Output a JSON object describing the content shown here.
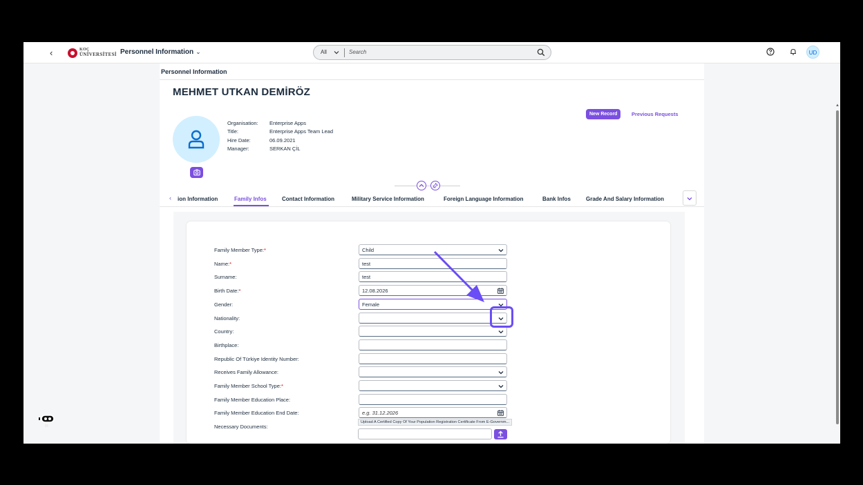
{
  "shell": {
    "back_icon": "chevron-left-icon",
    "logo_line1": "KOÇ",
    "logo_line2": "ÜNİVERSİTESİ",
    "app_title": "Personnel Information",
    "search_scope": "All",
    "search_placeholder": "Search",
    "avatar_initials": "UD"
  },
  "page": {
    "title": "Personnel Information",
    "employee_name": "MEHMET UTKAN DEMİRÖZ",
    "new_record_label": "New Record",
    "previous_requests_label": "Previous Requests"
  },
  "employee_info": [
    {
      "key": "Organisation:",
      "value": "Enterprise Apps"
    },
    {
      "key": "Title:",
      "value": "Enterprise Apps Team Lead"
    },
    {
      "key": "Hire Date:",
      "value": "06.09.2021"
    },
    {
      "key": "Manager:",
      "value": "SERKAN ÇİL"
    }
  ],
  "tabs": [
    {
      "label": "ion Information",
      "active": false
    },
    {
      "label": "Family Infos",
      "active": true
    },
    {
      "label": "Contact Information",
      "active": false
    },
    {
      "label": "Military Service Information",
      "active": false
    },
    {
      "label": "Foreign Language Information",
      "active": false
    },
    {
      "label": "Bank Infos",
      "active": false
    },
    {
      "label": "Grade And Salary Information",
      "active": false
    }
  ],
  "form": {
    "fields": [
      {
        "label": "Family Member Type:",
        "required": true,
        "value": "Child",
        "type": "select"
      },
      {
        "label": "Name:",
        "required": true,
        "value": "test",
        "type": "text"
      },
      {
        "label": "Surname:",
        "required": false,
        "value": "test",
        "type": "text"
      },
      {
        "label": "Birth Date:",
        "required": true,
        "value": "12.08.2026",
        "type": "date"
      },
      {
        "label": "Gender:",
        "required": false,
        "value": "Female",
        "type": "select"
      },
      {
        "label": "Nationality:",
        "required": false,
        "value": "",
        "type": "select"
      },
      {
        "label": "Country:",
        "required": false,
        "value": "",
        "type": "select"
      },
      {
        "label": "Birthplace:",
        "required": false,
        "value": "",
        "type": "text"
      },
      {
        "label": "Republic Of Türkiye Identity Number:",
        "required": false,
        "value": "",
        "type": "text"
      },
      {
        "label": "Receives Family Allowance:",
        "required": false,
        "value": "",
        "type": "select"
      },
      {
        "label": "Family Member School Type:",
        "required": true,
        "value": "",
        "type": "select"
      },
      {
        "label": "Family Member Education Place:",
        "required": false,
        "value": "",
        "type": "text"
      },
      {
        "label": "Family Member Education End Date:",
        "required": false,
        "value": "",
        "placeholder": "e.g. 31.12.2026",
        "type": "date"
      }
    ],
    "necessary_documents_label": "Necessary Documents:",
    "upload_hint": "Upload A Certified Copy Of Your Population Registration Certificate From E-Governm..."
  },
  "colors": {
    "accent": "#7b4fe0",
    "highlight": "#6a4df5",
    "required": "#d20a0a"
  }
}
